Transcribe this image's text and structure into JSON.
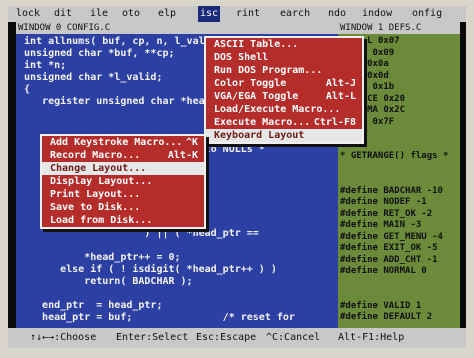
{
  "menubar": {
    "items": [
      {
        "label": "lock"
      },
      {
        "label": "dit"
      },
      {
        "label": "ile"
      },
      {
        "label": "oto"
      },
      {
        "label": "elp"
      },
      {
        "label": "isc"
      },
      {
        "label": "rint"
      },
      {
        "label": "earch"
      },
      {
        "label": "ndo"
      },
      {
        "label": "indow"
      },
      {
        "label": "onfig"
      }
    ]
  },
  "left_window": {
    "title": "WINDOW 0 CONFIG.C",
    "lines": [
      "int allnums( buf, cp, n, l_valid",
      "unsigned char *buf, **cp;",
      "int *n;",
      "unsigned char *l_valid;",
      "{",
      "   register unsigned char *head",
      "",
      "",
      "",
      "                    converted to NULLs *",
      "",
      "",
      "",
      "",
      "",
      "",
      "                    ) || ( *head_ptr ==",
      "",
      "          *head_ptr++ = 0;",
      "      else if ( ! isdigit( *head_ptr++ ) )",
      "          return( BADCHAR );",
      "",
      "   end_ptr  = head_ptr;",
      "   head_ptr = buf;               /* reset for"
    ]
  },
  "right_window": {
    "title": "WINDOW 1 DEFS.C",
    "lines": [
      "# BELL 0x07",
      "# TAB 0x09",
      "# LF 0x0a",
      "# CR 0x0d",
      "# ESC 0x1b",
      "# SPACE 0x20",
      "# COMMA 0x2C",
      "# DEL 0x7F",
      "",
      "",
      "* GETRANGE() flags *",
      "",
      "",
      "#define BADCHAR -10",
      "#define NODEF -1",
      "#define RET_OK -2",
      "#define MAIN -3",
      "#define GET_MENU -4",
      "#define EXIT_OK -5",
      "#define ADD_CHT -1",
      "#define NORMAL 0",
      "",
      "",
      "#define VALID 1",
      "#define DEFAULT 2"
    ]
  },
  "misc_menu": {
    "items": [
      {
        "label": "ASCII Table...",
        "key": ""
      },
      {
        "label": "DOS Shell",
        "key": ""
      },
      {
        "label": "Run DOS Program...",
        "key": ""
      },
      {
        "label": "Color Toggle",
        "key": "Alt-J"
      },
      {
        "label": "VGA/EGA Toggle",
        "key": "Alt-L"
      },
      {
        "label": "Load/Execute Macro...",
        "key": ""
      },
      {
        "label": "Execute Macro...",
        "key": "Ctrl-F8"
      },
      {
        "label": "Keyboard Layout",
        "key": ""
      }
    ],
    "selected_index": 7
  },
  "keyboard_submenu": {
    "items": [
      {
        "label": "Add Keystroke Macro...",
        "key": "^K"
      },
      {
        "label": "Record Macro...",
        "key": "Alt-K"
      },
      {
        "label": "Change Layout...",
        "key": ""
      },
      {
        "label": "Display Layout...",
        "key": ""
      },
      {
        "label": "Print Layout...",
        "key": ""
      },
      {
        "label": "Save to Disk...",
        "key": ""
      },
      {
        "label": "Load from Disk...",
        "key": ""
      }
    ],
    "selected_index": 2
  },
  "statusbar": {
    "choose": "↑↓←→:Choose",
    "select": "Enter:Select",
    "escape": "Esc:Escape",
    "cancel": "^C:Cancel",
    "help": "Alt-F1:Help"
  },
  "colors": {
    "menu_bg": "#b52d2a",
    "left_bg": "#2c3fa2",
    "right_bg": "#6b8a3a",
    "bar_bg": "#c8c8c8"
  }
}
